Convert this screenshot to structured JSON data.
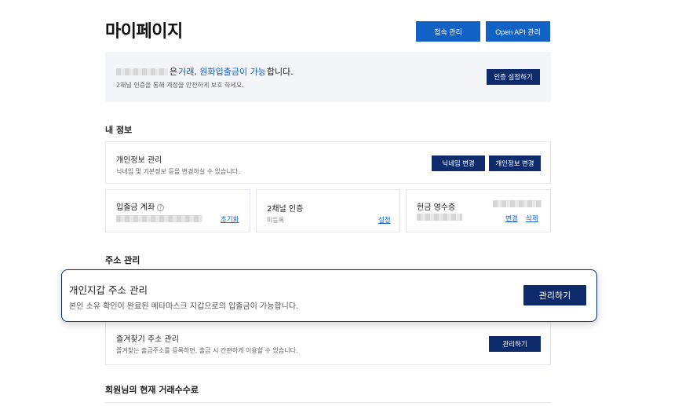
{
  "header": {
    "title": "마이페이지",
    "access_button": "접속 관리",
    "api_button": "Open API 관리"
  },
  "notice": {
    "text_prefix": "은",
    "highlight": "거래, 원화입출금이 가능",
    "text_suffix": "합니다.",
    "subtext": "2채널 인증을 통해 계정을 안전하게 보호 하세요.",
    "button": "인증 설정하기"
  },
  "my_info": {
    "section_title": "내 정보",
    "personal": {
      "title": "개인정보 관리",
      "subtitle": "닉네임 및 기본정보 등을 변경하실 수 있습니다.",
      "nickname_button": "닉네임 변경",
      "info_button": "개인정보 변경"
    },
    "account": {
      "title": "입출금 계좌",
      "help_icon": "?",
      "link": "초기화"
    },
    "two_channel": {
      "title": "2채널 인증",
      "status": "미등록",
      "link": "설정"
    },
    "receipt": {
      "title": "현금 영수증",
      "link_change": "변경",
      "link_delete": "삭제"
    }
  },
  "address": {
    "section_title": "주소 관리",
    "wallet": {
      "title": "개인지갑 주소 관리",
      "subtitle": "본인 소유 확인이 완료된 메타마스크 지갑으로의 입출금이 가능합니다.",
      "button": "관리하기"
    },
    "favorites": {
      "title": "즐겨찾기 주소 관리",
      "subtitle": "즐겨찾는 출금주소를 등록하면, 출금 시 간편하게 이용할 수 있습니다.",
      "button": "관리하기"
    }
  },
  "fees": {
    "section_title": "회원님의 현재 거래수수료"
  },
  "colors": {
    "primary_blue": "#1261c4",
    "navy": "#0d2b6b",
    "notice_bg": "#f4f5f8",
    "border": "#e3e5ea"
  }
}
